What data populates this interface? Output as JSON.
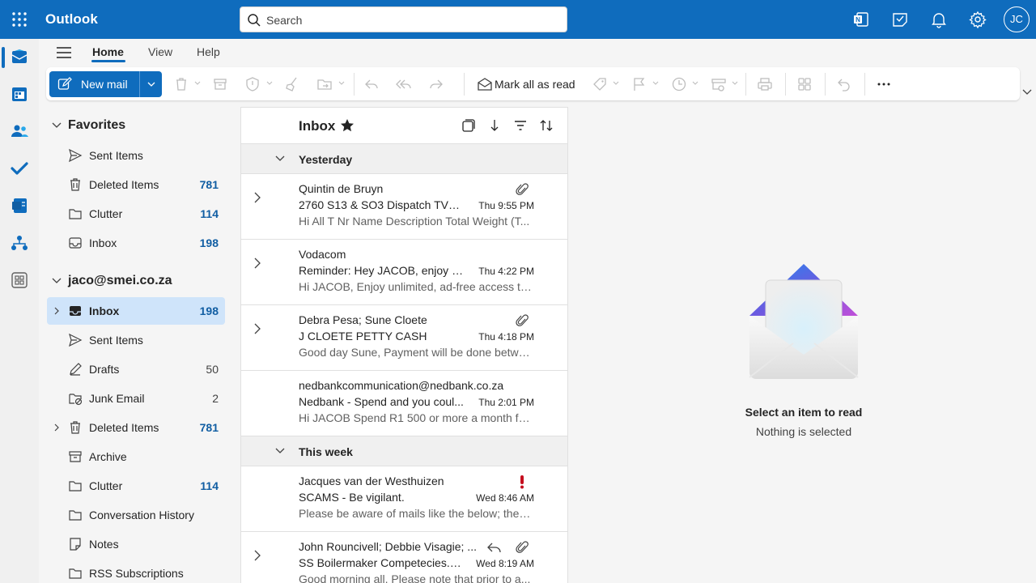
{
  "app": {
    "name": "Outlook",
    "user_initials": "JC"
  },
  "search": {
    "placeholder": "Search"
  },
  "tabs": [
    {
      "label": "Home",
      "active": true
    },
    {
      "label": "View",
      "active": false
    },
    {
      "label": "Help",
      "active": false
    }
  ],
  "ribbon": {
    "new_mail_label": "New mail",
    "mark_all_read_label": "Mark all as read"
  },
  "favorites": {
    "title": "Favorites",
    "items": [
      {
        "label": "Sent Items",
        "icon": "send-icon",
        "count": ""
      },
      {
        "label": "Deleted Items",
        "icon": "trash-icon",
        "count": "781"
      },
      {
        "label": "Clutter",
        "icon": "folder-icon",
        "count": "114"
      },
      {
        "label": "Inbox",
        "icon": "inbox-icon",
        "count": "198"
      }
    ]
  },
  "account": {
    "title": "jaco@smei.co.za",
    "items": [
      {
        "label": "Inbox",
        "icon": "inbox-icon",
        "count": "198",
        "selected": true,
        "expandable": true
      },
      {
        "label": "Sent Items",
        "icon": "send-icon",
        "count": ""
      },
      {
        "label": "Drafts",
        "icon": "pencil-icon",
        "count": "50"
      },
      {
        "label": "Junk Email",
        "icon": "junk-icon",
        "count": "2"
      },
      {
        "label": "Deleted Items",
        "icon": "trash-icon",
        "count": "781",
        "expandable": true
      },
      {
        "label": "Archive",
        "icon": "archive-icon",
        "count": ""
      },
      {
        "label": "Clutter",
        "icon": "folder-icon",
        "count": "114"
      },
      {
        "label": "Conversation History",
        "icon": "folder-icon",
        "count": ""
      },
      {
        "label": "Notes",
        "icon": "note-icon",
        "count": ""
      },
      {
        "label": "RSS Subscriptions",
        "icon": "folder-icon",
        "count": ""
      }
    ]
  },
  "message_list": {
    "title": "Inbox",
    "groups": [
      {
        "label": "Yesterday"
      },
      {
        "label": "This week"
      }
    ],
    "messages": [
      {
        "sender": "Quintin de Bruyn",
        "subject": "2760 S13 & SO3 Dispatch TVL t...",
        "time": "Thu 9:55 PM",
        "preview": "Hi All T Nr Name Description Total Weight (T...",
        "attachment": true
      },
      {
        "sender": "Vodacom",
        "subject": "Reminder: Hey JACOB, enjoy Pri...",
        "time": "Thu 4:22 PM",
        "preview": "Hi JACOB, Enjoy unlimited, ad-free access to ...",
        "attachment": false
      },
      {
        "sender": "Debra Pesa; Sune Cloete",
        "subject": "J CLOETE PETTY CASH",
        "time": "Thu 4:18 PM",
        "preview": "Good day Sune, Payment will be done betwe...",
        "attachment": true
      },
      {
        "sender": "nedbankcommunication@nedbank.co.za",
        "subject": "Nedbank - Spend and you coul...",
        "time": "Thu 2:01 PM",
        "preview": "Hi JACOB Spend R1 500 or more a month for...",
        "attachment": false
      },
      {
        "sender": "Jacques van der Westhuizen",
        "subject": "SCAMS - Be vigilant.",
        "time": "Wed 8:46 AM",
        "preview": "Please be aware of mails like the below; they ...",
        "important": true
      },
      {
        "sender": "John Rouncivell; Debbie Visagie; ...",
        "subject": "SS Boilermaker Competecies.xlsx",
        "time": "Wed 8:19 AM",
        "preview": "Good morning all, Please note that prior to a...",
        "attachment": true,
        "replied": true
      }
    ]
  },
  "reading_pane": {
    "title": "Select an item to read",
    "subtitle": "Nothing is selected"
  },
  "colors": {
    "brand": "#0f6cbd",
    "selected": "#cfe4fa",
    "important": "#c50f1f"
  }
}
